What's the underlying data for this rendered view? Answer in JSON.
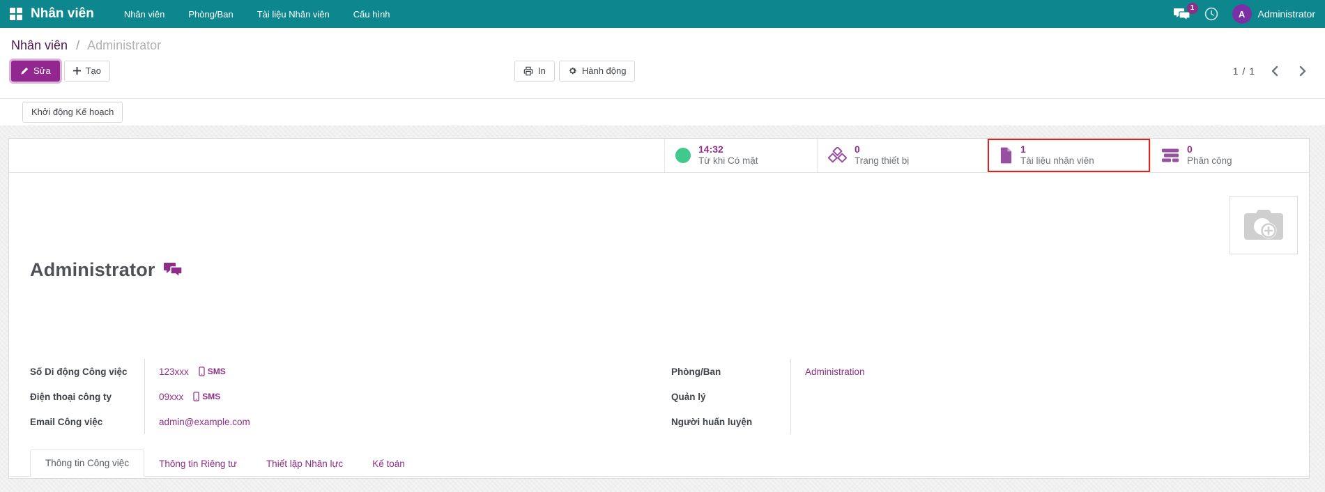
{
  "colors": {
    "navbar-bg": "#0d878d",
    "primary": "#8f2e88",
    "primary-button": "#92278f",
    "breadcrumb-link": "#4c1a50",
    "success": "#41c98c",
    "icon-purple": "#9750a1",
    "highlight-red": "#e01f1f"
  },
  "navbar": {
    "app_title": "Nhân viên",
    "menus": [
      {
        "label": "Nhân viên"
      },
      {
        "label": "Phòng/Ban"
      },
      {
        "label": "Tài liệu Nhân viên"
      },
      {
        "label": "Cấu hình"
      }
    ],
    "messages_badge": "1",
    "user": {
      "initial": "A",
      "name": "Administrator"
    }
  },
  "breadcrumb": {
    "parent": "Nhân viên",
    "separator": "/",
    "current": "Administrator"
  },
  "control_panel": {
    "edit": "Sửa",
    "create": "Tạo",
    "print": "In",
    "action": "Hành động",
    "pager": {
      "value": "1 / 1"
    }
  },
  "plan_bar": {
    "launch_plan": "Khởi động Kế hoạch"
  },
  "stat_buttons": [
    {
      "icon": "presence-icon",
      "value": "14:32",
      "label": "Từ khi Có mặt",
      "highlighted": false
    },
    {
      "icon": "cubes-icon",
      "value": "0",
      "label": "Trang thiết bị",
      "highlighted": false
    },
    {
      "icon": "document-icon",
      "value": "1",
      "label": "Tài liệu nhân viên",
      "highlighted": true
    },
    {
      "icon": "assignments-icon",
      "value": "0",
      "label": "Phân công",
      "highlighted": false
    }
  ],
  "employee": {
    "name": "Administrator"
  },
  "fields": {
    "left": [
      {
        "label": "Số Di động Công việc",
        "value": "123xxx",
        "sms": "SMS"
      },
      {
        "label": "Điện thoại công ty",
        "value": "09xxx",
        "sms": "SMS"
      },
      {
        "label": "Email Công việc",
        "value": "admin@example.com",
        "sms": ""
      }
    ],
    "right": [
      {
        "label": "Phòng/Ban",
        "value": "Administration"
      },
      {
        "label": "Quản lý",
        "value": ""
      },
      {
        "label": "Người huấn luyện",
        "value": ""
      }
    ]
  },
  "tabs": [
    {
      "label": "Thông tin Công việc"
    },
    {
      "label": "Thông tin Riêng tư"
    },
    {
      "label": "Thiết lập Nhân lực"
    },
    {
      "label": "Kế toán"
    }
  ]
}
